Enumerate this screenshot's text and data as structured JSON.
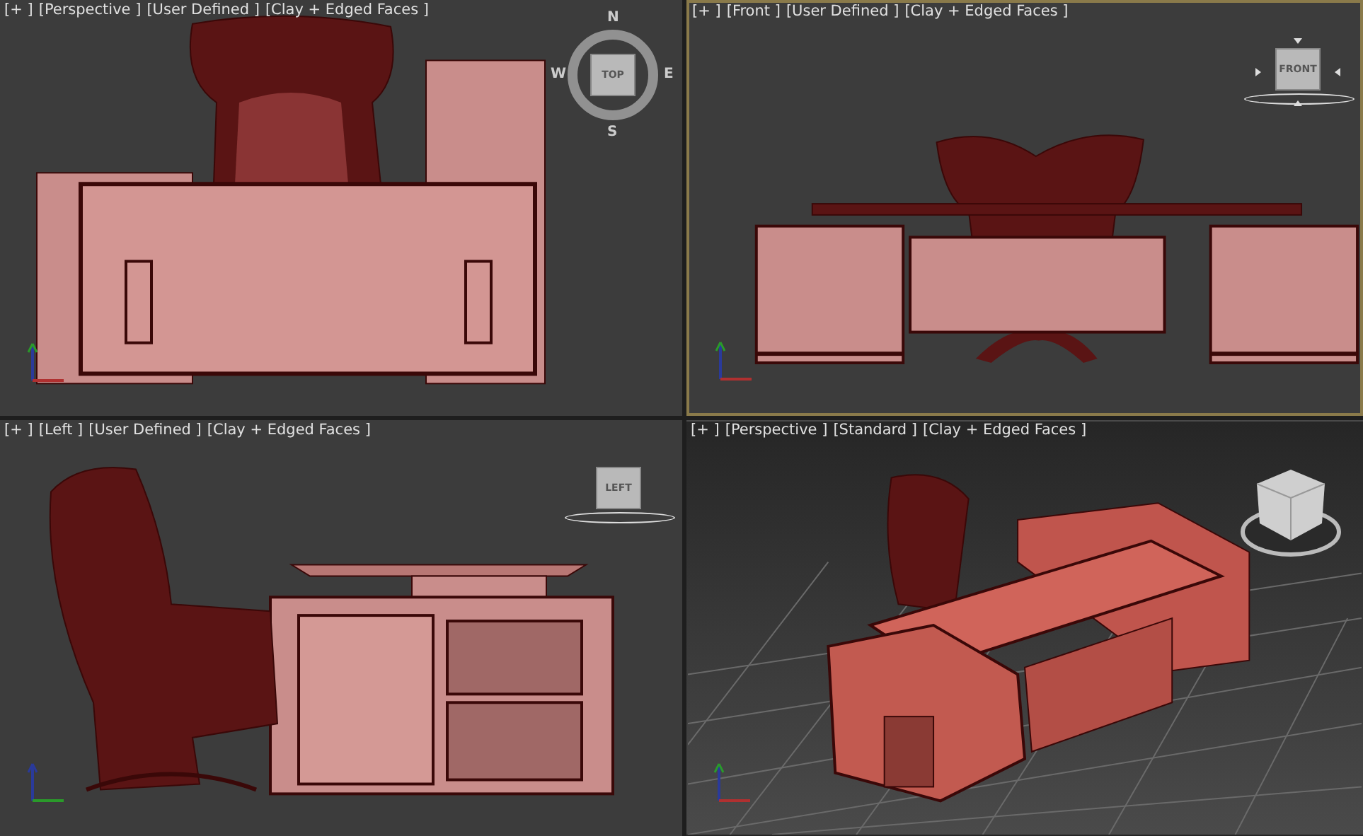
{
  "viewports": [
    {
      "kind": "top",
      "selected": false,
      "label": [
        "[+ ]",
        "[Perspective ]",
        "[User Defined ]",
        "[Clay + Edged Faces ]"
      ],
      "viewcube": {
        "kind": "compass",
        "face": "TOP",
        "compass": [
          "N",
          "W",
          "E",
          "S"
        ]
      }
    },
    {
      "kind": "front",
      "selected": true,
      "label": [
        "[+ ]",
        "[Front ]",
        "[User Defined ]",
        "[Clay + Edged Faces ]"
      ],
      "viewcube": {
        "kind": "flat",
        "face": "FRONT",
        "arrows": true
      }
    },
    {
      "kind": "left",
      "selected": false,
      "label": [
        "[+ ]",
        "[Left ]",
        "[User Defined ]",
        "[Clay + Edged Faces ]"
      ],
      "viewcube": {
        "kind": "flat",
        "face": "LEFT",
        "arrows": false
      }
    },
    {
      "kind": "perspective",
      "selected": false,
      "label": [
        "[+ ]",
        "[Perspective ]",
        "[Standard ]",
        "[Clay + Edged Faces ]"
      ],
      "viewcube": {
        "kind": "cube"
      }
    }
  ]
}
